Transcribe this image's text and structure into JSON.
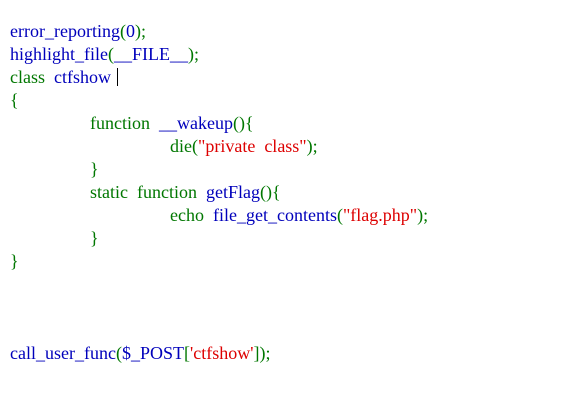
{
  "code": {
    "lines": [
      {
        "indent": 0,
        "tokens": [
          {
            "t": "fn",
            "v": "error_reporting"
          },
          {
            "t": "punc",
            "v": "("
          },
          {
            "t": "fn",
            "v": "0"
          },
          {
            "t": "punc",
            "v": ");"
          }
        ]
      },
      {
        "indent": 0,
        "tokens": [
          {
            "t": "fn",
            "v": "highlight_file"
          },
          {
            "t": "punc",
            "v": "("
          },
          {
            "t": "fn",
            "v": "__FILE__"
          },
          {
            "t": "punc",
            "v": ");"
          }
        ]
      },
      {
        "indent": 0,
        "caret": true,
        "tokens": [
          {
            "t": "kw",
            "v": "class"
          },
          {
            "t": "fn",
            "v": "  ctfshow"
          }
        ]
      },
      {
        "indent": 0,
        "tokens": [
          {
            "t": "punc",
            "v": "{"
          }
        ]
      },
      {
        "indent": 1,
        "tokens": [
          {
            "t": "kw",
            "v": "function"
          },
          {
            "t": "fn",
            "v": "  __wakeup"
          },
          {
            "t": "punc",
            "v": "(){"
          }
        ]
      },
      {
        "indent": 2,
        "tokens": [
          {
            "t": "kw",
            "v": "die"
          },
          {
            "t": "punc",
            "v": "("
          },
          {
            "t": "str",
            "v": "\"private  class\""
          },
          {
            "t": "punc",
            "v": ");"
          }
        ]
      },
      {
        "indent": 1,
        "tokens": [
          {
            "t": "punc",
            "v": "}"
          }
        ]
      },
      {
        "indent": 1,
        "tokens": [
          {
            "t": "kw",
            "v": "static"
          },
          {
            "t": "kw",
            "v": "  function"
          },
          {
            "t": "fn",
            "v": "  getFlag"
          },
          {
            "t": "punc",
            "v": "(){"
          }
        ]
      },
      {
        "indent": 2,
        "tokens": [
          {
            "t": "kw",
            "v": "echo"
          },
          {
            "t": "fn",
            "v": "  file_get_contents"
          },
          {
            "t": "punc",
            "v": "("
          },
          {
            "t": "str",
            "v": "\"flag.php\""
          },
          {
            "t": "punc",
            "v": ");"
          }
        ]
      },
      {
        "indent": 1,
        "tokens": [
          {
            "t": "punc",
            "v": "}"
          }
        ]
      },
      {
        "indent": 0,
        "tokens": [
          {
            "t": "punc",
            "v": "}"
          }
        ]
      },
      {
        "indent": 0,
        "tokens": []
      },
      {
        "indent": 0,
        "tokens": []
      },
      {
        "indent": 0,
        "tokens": []
      },
      {
        "indent": 0,
        "tokens": [
          {
            "t": "fn",
            "v": "call_user_func"
          },
          {
            "t": "punc",
            "v": "("
          },
          {
            "t": "fn",
            "v": "$_POST"
          },
          {
            "t": "punc",
            "v": "["
          },
          {
            "t": "str",
            "v": "'ctfshow'"
          },
          {
            "t": "punc",
            "v": "]);"
          }
        ]
      }
    ]
  },
  "colors": {
    "keyword": "#007700",
    "identifier": "#0000bb",
    "string": "#dd0000",
    "background": "#ffffff"
  }
}
